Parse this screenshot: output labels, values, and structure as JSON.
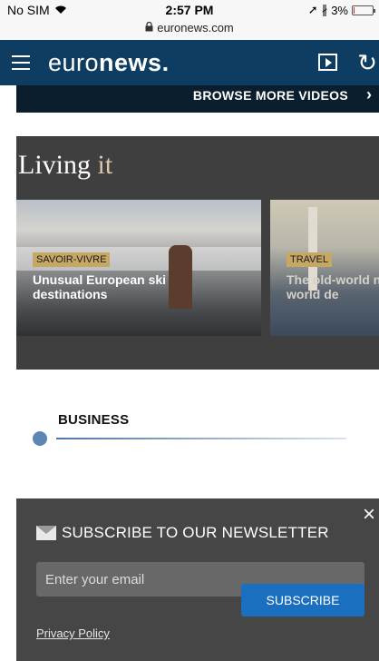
{
  "status_bar": {
    "carrier": "No SIM",
    "time": "2:57 PM",
    "url": "euronews.com",
    "battery": "3%",
    "battery_level": 0.03
  },
  "header": {
    "logo_prefix": "euro",
    "logo_suffix": "news.",
    "icons": [
      "menu-icon",
      "video-icon",
      "refresh-icon"
    ]
  },
  "browse": {
    "label": "BROWSE MORE VIDEOS",
    "chevron": "›"
  },
  "living": {
    "title_main": "Living",
    "title_accent": "it",
    "cards": [
      {
        "tag": "SAVOIR-VIVRE",
        "title": "Unusual European ski destinations"
      },
      {
        "tag": "TRAVEL",
        "title": "The old-world new-world de"
      }
    ]
  },
  "business": {
    "label": "BUSINESS"
  },
  "newsletter": {
    "title": "SUBSCRIBE TO OUR NEWSLETTER",
    "email_placeholder": "Enter your email",
    "privacy_label": "Privacy Policy",
    "subscribe_label": "SUBSCRIBE",
    "close_glyph": "×"
  },
  "colors": {
    "header_bg": "#0e3d61",
    "accent_blue": "#1b6fbf",
    "tag_gold": "#c5a865"
  }
}
